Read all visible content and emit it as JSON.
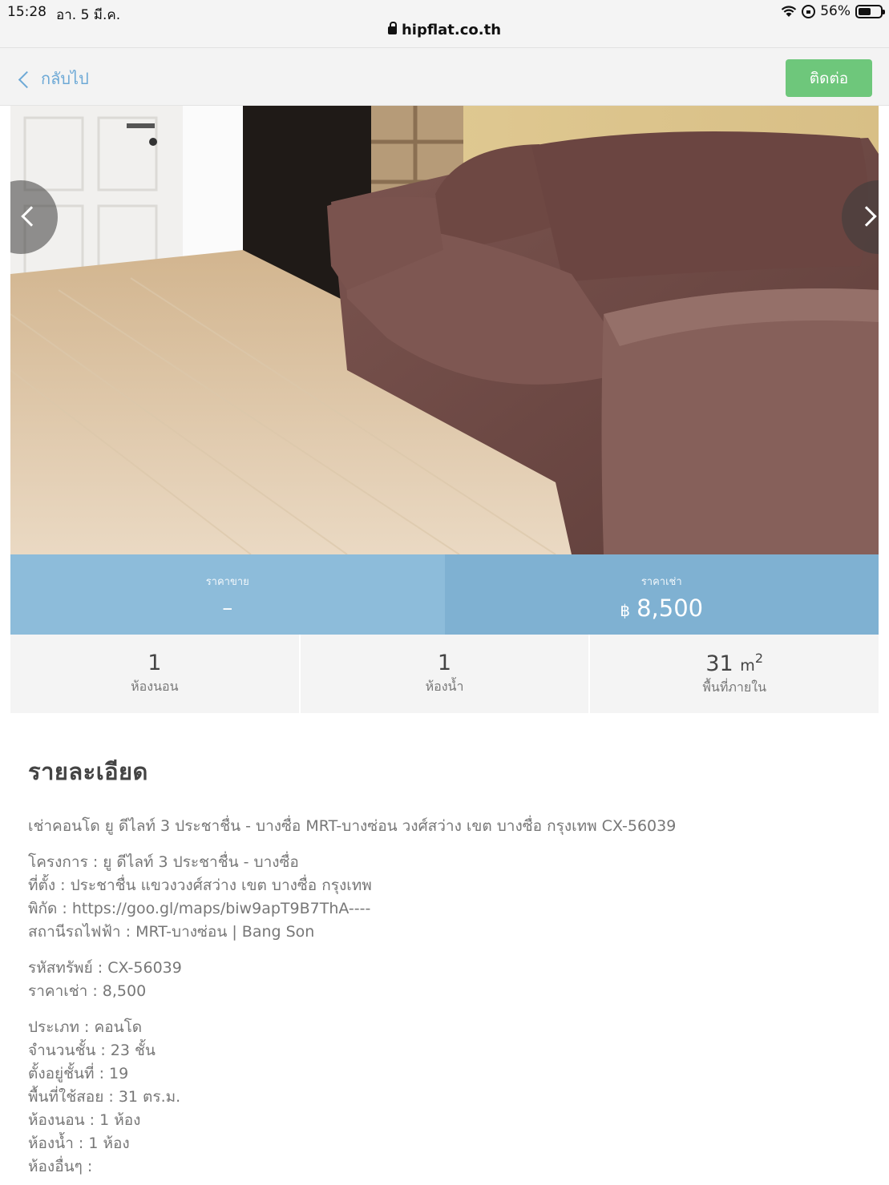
{
  "status_bar": {
    "time": "15:28",
    "date": "อา. 5 มี.ค.",
    "url": "hipflat.co.th",
    "battery": "56%",
    "battery_level": 0.56
  },
  "nav": {
    "back_label": "กลับไป",
    "contact_label": "ติดต่อ"
  },
  "price": {
    "sale_label": "ราคาขาย",
    "sale_value": "–",
    "rent_label": "ราคาเช่า",
    "currency": "฿",
    "rent_value": "8,500"
  },
  "stats": {
    "bedrooms_value": "1",
    "bedrooms_label": "ห้องนอน",
    "bathrooms_value": "1",
    "bathrooms_label": "ห้องน้ำ",
    "area_value": "31",
    "area_unit": "m",
    "area_sup": "2",
    "area_label": "พื้นที่ภายใน"
  },
  "details": {
    "title": "รายละเอียด",
    "summary": "เช่าคอนโด ยู ดีไลท์ 3 ประชาชื่น - บางซื่อ MRT-บางซ่อน วงศ์สว่าง เขต บางซื่อ กรุงเทพ CX-56039",
    "block1": [
      "โครงการ : ยู ดีไลท์ 3 ประชาชื่น - บางซื่อ",
      "ที่ตั้ง : ประชาชื่น แขวงวงศ์สว่าง เขต บางซื่อ กรุงเทพ",
      "พิกัด : https://goo.gl/maps/biw9apT9B7ThA----",
      "สถานีรถไฟฟ้า : MRT-บางซ่อน | Bang Son"
    ],
    "block2": [
      "รหัสทรัพย์ : CX-56039",
      "ราคาเช่า : 8,500"
    ],
    "block3": [
      "ประเภท : คอนโด",
      "จำนวนชั้น : 23 ชั้น",
      "ตั้งอยู่ชั้นที่ : 19",
      "พื้นที่ใช้สอย : 31 ตร.ม.",
      "ห้องนอน : 1 ห้อง",
      "ห้องน้ำ : 1 ห้อง",
      "ห้องอื่นๆ :"
    ]
  }
}
